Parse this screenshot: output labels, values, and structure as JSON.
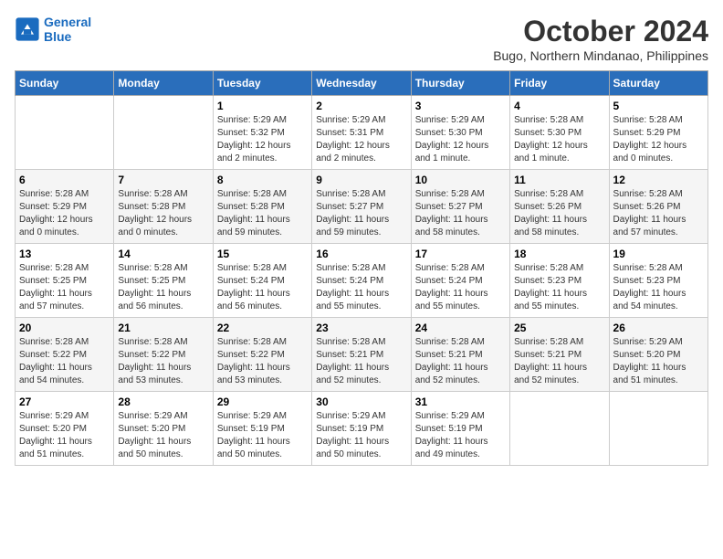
{
  "header": {
    "logo_line1": "General",
    "logo_line2": "Blue",
    "title": "October 2024",
    "subtitle": "Bugo, Northern Mindanao, Philippines"
  },
  "days_of_week": [
    "Sunday",
    "Monday",
    "Tuesday",
    "Wednesday",
    "Thursday",
    "Friday",
    "Saturday"
  ],
  "weeks": [
    [
      {
        "day": "",
        "info": ""
      },
      {
        "day": "",
        "info": ""
      },
      {
        "day": "1",
        "info": "Sunrise: 5:29 AM\nSunset: 5:32 PM\nDaylight: 12 hours\nand 2 minutes."
      },
      {
        "day": "2",
        "info": "Sunrise: 5:29 AM\nSunset: 5:31 PM\nDaylight: 12 hours\nand 2 minutes."
      },
      {
        "day": "3",
        "info": "Sunrise: 5:29 AM\nSunset: 5:30 PM\nDaylight: 12 hours\nand 1 minute."
      },
      {
        "day": "4",
        "info": "Sunrise: 5:28 AM\nSunset: 5:30 PM\nDaylight: 12 hours\nand 1 minute."
      },
      {
        "day": "5",
        "info": "Sunrise: 5:28 AM\nSunset: 5:29 PM\nDaylight: 12 hours\nand 0 minutes."
      }
    ],
    [
      {
        "day": "6",
        "info": "Sunrise: 5:28 AM\nSunset: 5:29 PM\nDaylight: 12 hours\nand 0 minutes."
      },
      {
        "day": "7",
        "info": "Sunrise: 5:28 AM\nSunset: 5:28 PM\nDaylight: 12 hours\nand 0 minutes."
      },
      {
        "day": "8",
        "info": "Sunrise: 5:28 AM\nSunset: 5:28 PM\nDaylight: 11 hours\nand 59 minutes."
      },
      {
        "day": "9",
        "info": "Sunrise: 5:28 AM\nSunset: 5:27 PM\nDaylight: 11 hours\nand 59 minutes."
      },
      {
        "day": "10",
        "info": "Sunrise: 5:28 AM\nSunset: 5:27 PM\nDaylight: 11 hours\nand 58 minutes."
      },
      {
        "day": "11",
        "info": "Sunrise: 5:28 AM\nSunset: 5:26 PM\nDaylight: 11 hours\nand 58 minutes."
      },
      {
        "day": "12",
        "info": "Sunrise: 5:28 AM\nSunset: 5:26 PM\nDaylight: 11 hours\nand 57 minutes."
      }
    ],
    [
      {
        "day": "13",
        "info": "Sunrise: 5:28 AM\nSunset: 5:25 PM\nDaylight: 11 hours\nand 57 minutes."
      },
      {
        "day": "14",
        "info": "Sunrise: 5:28 AM\nSunset: 5:25 PM\nDaylight: 11 hours\nand 56 minutes."
      },
      {
        "day": "15",
        "info": "Sunrise: 5:28 AM\nSunset: 5:24 PM\nDaylight: 11 hours\nand 56 minutes."
      },
      {
        "day": "16",
        "info": "Sunrise: 5:28 AM\nSunset: 5:24 PM\nDaylight: 11 hours\nand 55 minutes."
      },
      {
        "day": "17",
        "info": "Sunrise: 5:28 AM\nSunset: 5:24 PM\nDaylight: 11 hours\nand 55 minutes."
      },
      {
        "day": "18",
        "info": "Sunrise: 5:28 AM\nSunset: 5:23 PM\nDaylight: 11 hours\nand 55 minutes."
      },
      {
        "day": "19",
        "info": "Sunrise: 5:28 AM\nSunset: 5:23 PM\nDaylight: 11 hours\nand 54 minutes."
      }
    ],
    [
      {
        "day": "20",
        "info": "Sunrise: 5:28 AM\nSunset: 5:22 PM\nDaylight: 11 hours\nand 54 minutes."
      },
      {
        "day": "21",
        "info": "Sunrise: 5:28 AM\nSunset: 5:22 PM\nDaylight: 11 hours\nand 53 minutes."
      },
      {
        "day": "22",
        "info": "Sunrise: 5:28 AM\nSunset: 5:22 PM\nDaylight: 11 hours\nand 53 minutes."
      },
      {
        "day": "23",
        "info": "Sunrise: 5:28 AM\nSunset: 5:21 PM\nDaylight: 11 hours\nand 52 minutes."
      },
      {
        "day": "24",
        "info": "Sunrise: 5:28 AM\nSunset: 5:21 PM\nDaylight: 11 hours\nand 52 minutes."
      },
      {
        "day": "25",
        "info": "Sunrise: 5:28 AM\nSunset: 5:21 PM\nDaylight: 11 hours\nand 52 minutes."
      },
      {
        "day": "26",
        "info": "Sunrise: 5:29 AM\nSunset: 5:20 PM\nDaylight: 11 hours\nand 51 minutes."
      }
    ],
    [
      {
        "day": "27",
        "info": "Sunrise: 5:29 AM\nSunset: 5:20 PM\nDaylight: 11 hours\nand 51 minutes."
      },
      {
        "day": "28",
        "info": "Sunrise: 5:29 AM\nSunset: 5:20 PM\nDaylight: 11 hours\nand 50 minutes."
      },
      {
        "day": "29",
        "info": "Sunrise: 5:29 AM\nSunset: 5:19 PM\nDaylight: 11 hours\nand 50 minutes."
      },
      {
        "day": "30",
        "info": "Sunrise: 5:29 AM\nSunset: 5:19 PM\nDaylight: 11 hours\nand 50 minutes."
      },
      {
        "day": "31",
        "info": "Sunrise: 5:29 AM\nSunset: 5:19 PM\nDaylight: 11 hours\nand 49 minutes."
      },
      {
        "day": "",
        "info": ""
      },
      {
        "day": "",
        "info": ""
      }
    ]
  ]
}
